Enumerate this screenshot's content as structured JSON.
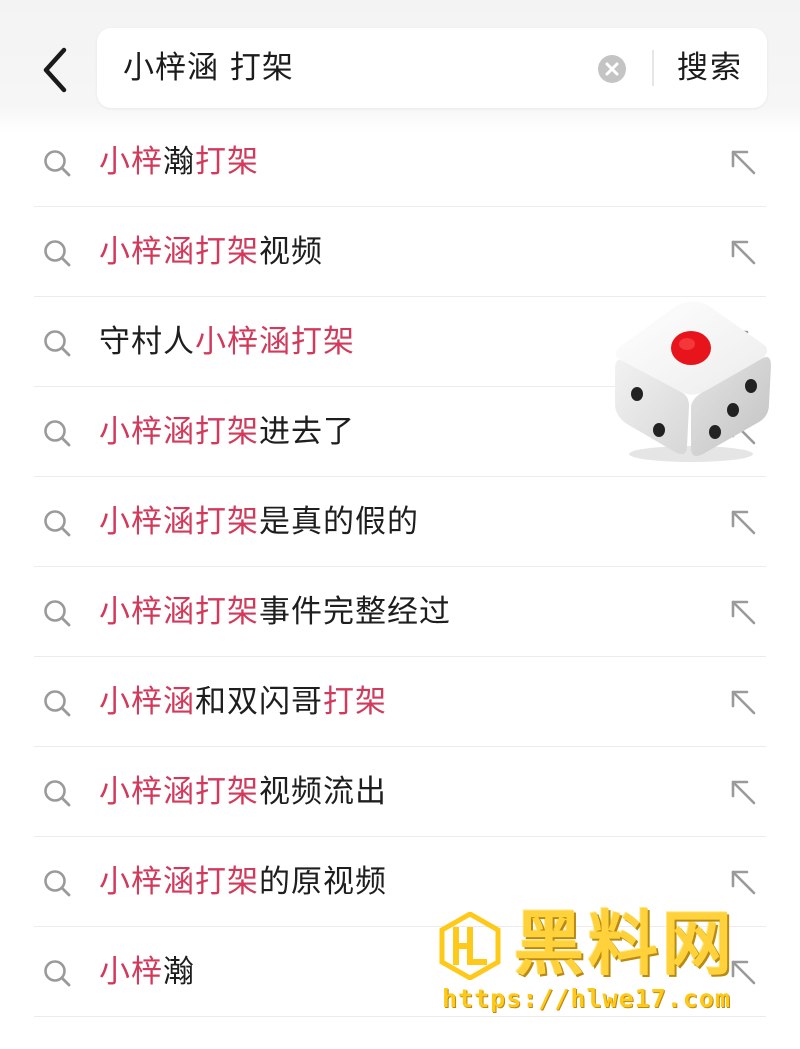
{
  "search": {
    "query": "小梓涵 打架",
    "button_label": "搜索"
  },
  "suggestions": [
    {
      "parts": [
        {
          "t": "小梓",
          "hl": true
        },
        {
          "t": "瀚",
          "hl": false
        },
        {
          "t": "打架",
          "hl": true
        }
      ]
    },
    {
      "parts": [
        {
          "t": "小梓涵打架",
          "hl": true
        },
        {
          "t": "视频",
          "hl": false
        }
      ]
    },
    {
      "parts": [
        {
          "t": "守村人",
          "hl": false
        },
        {
          "t": "小梓涵打架",
          "hl": true
        }
      ]
    },
    {
      "parts": [
        {
          "t": "小梓涵打架",
          "hl": true
        },
        {
          "t": "进去了",
          "hl": false
        }
      ]
    },
    {
      "parts": [
        {
          "t": "小梓涵打架",
          "hl": true
        },
        {
          "t": "是真的假的",
          "hl": false
        }
      ]
    },
    {
      "parts": [
        {
          "t": "小梓涵打架",
          "hl": true
        },
        {
          "t": "事件完整经过",
          "hl": false
        }
      ]
    },
    {
      "parts": [
        {
          "t": "小梓涵",
          "hl": true
        },
        {
          "t": "和双闪哥",
          "hl": false
        },
        {
          "t": "打架",
          "hl": true
        }
      ]
    },
    {
      "parts": [
        {
          "t": "小梓涵打架",
          "hl": true
        },
        {
          "t": "视频流出",
          "hl": false
        }
      ]
    },
    {
      "parts": [
        {
          "t": "小梓涵打架",
          "hl": true
        },
        {
          "t": "的原视频",
          "hl": false
        }
      ]
    },
    {
      "parts": [
        {
          "t": "小梓",
          "hl": true
        },
        {
          "t": "瀚",
          "hl": false
        }
      ]
    }
  ],
  "icons": {
    "back": "chevron-left-icon",
    "clear": "clear-circle-icon",
    "suggestion": "search-icon",
    "fill": "arrow-up-left-icon",
    "dice": "dice-icon"
  },
  "watermark": {
    "title": "黑料网",
    "url": "https://hlwe17.com"
  },
  "colors": {
    "highlight": "#d23a5c",
    "text": "#1e1e1e",
    "icon": "#9a9a9a",
    "watermark": "#ffd13a"
  }
}
